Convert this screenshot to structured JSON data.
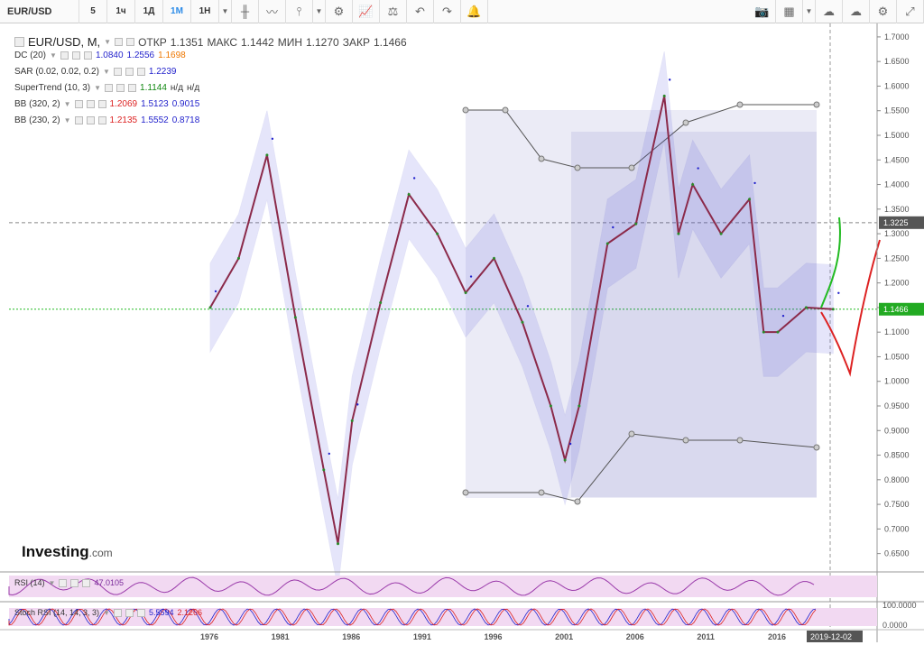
{
  "toolbar": {
    "symbol": "EUR/USD",
    "timeframes": [
      "5",
      "1ч",
      "1Д",
      "1М",
      "1Н"
    ],
    "active_timeframe": "1М"
  },
  "legend": {
    "title": "EUR/USD, M,",
    "open_label": "ОТКР",
    "open": "1.1351",
    "high_label": "МАКС",
    "high": "1.1442",
    "low_label": "МИН",
    "low": "1.1270",
    "close_label": "ЗАКР",
    "close": "1.1466",
    "indicators": [
      {
        "name": "DC (20)",
        "values": [
          "1.0840",
          "1.2556",
          "1.1698"
        ],
        "colors": [
          "#2222cc",
          "#2222cc",
          "#ee7700"
        ]
      },
      {
        "name": "SAR (0.02, 0.02, 0.2)",
        "values": [
          "1.2239"
        ],
        "colors": [
          "#2222cc"
        ]
      },
      {
        "name": "SuperTrend (10, 3)",
        "values": [
          "1.1144",
          "н/д",
          "н/д"
        ],
        "colors": [
          "#118811",
          "#333333",
          "#333333"
        ]
      },
      {
        "name": "BB (320, 2)",
        "values": [
          "1.2069",
          "1.5123",
          "0.9015"
        ],
        "colors": [
          "#dd2222",
          "#2222cc",
          "#2222cc"
        ]
      },
      {
        "name": "BB (230, 2)",
        "values": [
          "1.2135",
          "1.5552",
          "0.8718"
        ],
        "colors": [
          "#dd2222",
          "#2222cc",
          "#2222cc"
        ]
      }
    ]
  },
  "price_axis": {
    "ticks": [
      "1.7000",
      "1.6500",
      "1.6000",
      "1.5500",
      "1.5000",
      "1.4500",
      "1.4000",
      "1.3500",
      "1.3000",
      "1.2500",
      "1.2000",
      "1.1500",
      "1.1000",
      "1.0500",
      "1.0000",
      "0.9500",
      "0.9000",
      "0.8500",
      "0.8000",
      "0.7500",
      "0.7000",
      "0.6500"
    ],
    "current_price": "1.1466",
    "reference_price": "1.3225"
  },
  "time_axis": {
    "labels": [
      "1976",
      "1981",
      "1986",
      "1991",
      "1996",
      "2001",
      "2006",
      "2011",
      "2016"
    ],
    "current_date": "2019-12-02"
  },
  "watermark": {
    "brand": "Investing",
    "suffix": ".com"
  },
  "rsi": {
    "name": "RSI (14)",
    "value": "47.0105",
    "axis": [
      "100.0000",
      "0.0000"
    ]
  },
  "stoch": {
    "name": "Stoch RSI (14, 14, 3, 3)",
    "k": "5.5594",
    "d": "2.1266"
  },
  "chart_data": {
    "type": "line",
    "title": "EUR/USD, M",
    "xlabel": "",
    "ylabel": "",
    "ylim": [
      0.62,
      1.72
    ],
    "x": [
      1976,
      1978,
      1980,
      1982,
      1984,
      1985,
      1986,
      1988,
      1990,
      1992,
      1994,
      1996,
      1998,
      2000,
      2001,
      2002,
      2004,
      2006,
      2008,
      2009,
      2010,
      2012,
      2014,
      2015,
      2016,
      2018,
      2019.9
    ],
    "series": [
      {
        "name": "EUR/USD",
        "values": [
          1.15,
          1.25,
          1.46,
          1.13,
          0.82,
          0.67,
          0.92,
          1.16,
          1.38,
          1.3,
          1.18,
          1.25,
          1.12,
          0.95,
          0.84,
          0.95,
          1.28,
          1.32,
          1.58,
          1.3,
          1.4,
          1.3,
          1.37,
          1.1,
          1.1,
          1.15,
          1.1466
        ]
      }
    ]
  }
}
